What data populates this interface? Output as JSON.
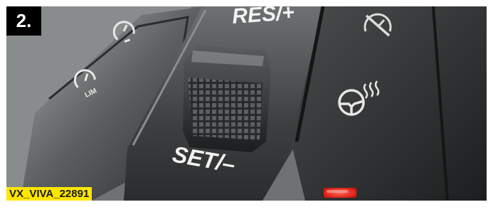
{
  "step_badge": "2.",
  "image_code": "VX_VIVA_22891",
  "controls": {
    "res_label": "RES/+",
    "set_label": "SET/–",
    "lim_label": "LIM"
  },
  "colors": {
    "badge_bg": "#000000",
    "code_bg": "#ffe600",
    "indicator_led": "#ff2a1a"
  },
  "icons": [
    "cruise-control-icon",
    "speed-limiter-icon",
    "cruise-cancel-icon",
    "heated-steering-wheel-icon"
  ]
}
